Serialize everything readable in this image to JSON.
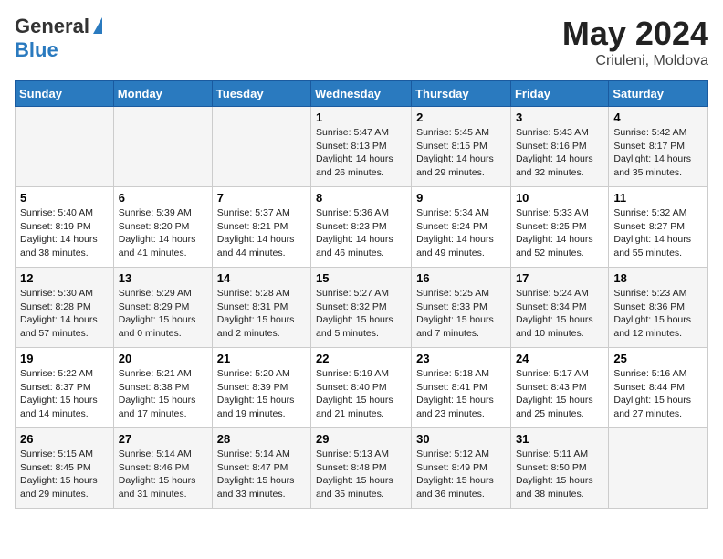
{
  "header": {
    "logo_general": "General",
    "logo_blue": "Blue",
    "title": "May 2024",
    "location": "Criuleni, Moldova"
  },
  "days_of_week": [
    "Sunday",
    "Monday",
    "Tuesday",
    "Wednesday",
    "Thursday",
    "Friday",
    "Saturday"
  ],
  "weeks": [
    [
      {
        "day": "",
        "info": ""
      },
      {
        "day": "",
        "info": ""
      },
      {
        "day": "",
        "info": ""
      },
      {
        "day": "1",
        "info": "Sunrise: 5:47 AM\nSunset: 8:13 PM\nDaylight: 14 hours and 26 minutes."
      },
      {
        "day": "2",
        "info": "Sunrise: 5:45 AM\nSunset: 8:15 PM\nDaylight: 14 hours and 29 minutes."
      },
      {
        "day": "3",
        "info": "Sunrise: 5:43 AM\nSunset: 8:16 PM\nDaylight: 14 hours and 32 minutes."
      },
      {
        "day": "4",
        "info": "Sunrise: 5:42 AM\nSunset: 8:17 PM\nDaylight: 14 hours and 35 minutes."
      }
    ],
    [
      {
        "day": "5",
        "info": "Sunrise: 5:40 AM\nSunset: 8:19 PM\nDaylight: 14 hours and 38 minutes."
      },
      {
        "day": "6",
        "info": "Sunrise: 5:39 AM\nSunset: 8:20 PM\nDaylight: 14 hours and 41 minutes."
      },
      {
        "day": "7",
        "info": "Sunrise: 5:37 AM\nSunset: 8:21 PM\nDaylight: 14 hours and 44 minutes."
      },
      {
        "day": "8",
        "info": "Sunrise: 5:36 AM\nSunset: 8:23 PM\nDaylight: 14 hours and 46 minutes."
      },
      {
        "day": "9",
        "info": "Sunrise: 5:34 AM\nSunset: 8:24 PM\nDaylight: 14 hours and 49 minutes."
      },
      {
        "day": "10",
        "info": "Sunrise: 5:33 AM\nSunset: 8:25 PM\nDaylight: 14 hours and 52 minutes."
      },
      {
        "day": "11",
        "info": "Sunrise: 5:32 AM\nSunset: 8:27 PM\nDaylight: 14 hours and 55 minutes."
      }
    ],
    [
      {
        "day": "12",
        "info": "Sunrise: 5:30 AM\nSunset: 8:28 PM\nDaylight: 14 hours and 57 minutes."
      },
      {
        "day": "13",
        "info": "Sunrise: 5:29 AM\nSunset: 8:29 PM\nDaylight: 15 hours and 0 minutes."
      },
      {
        "day": "14",
        "info": "Sunrise: 5:28 AM\nSunset: 8:31 PM\nDaylight: 15 hours and 2 minutes."
      },
      {
        "day": "15",
        "info": "Sunrise: 5:27 AM\nSunset: 8:32 PM\nDaylight: 15 hours and 5 minutes."
      },
      {
        "day": "16",
        "info": "Sunrise: 5:25 AM\nSunset: 8:33 PM\nDaylight: 15 hours and 7 minutes."
      },
      {
        "day": "17",
        "info": "Sunrise: 5:24 AM\nSunset: 8:34 PM\nDaylight: 15 hours and 10 minutes."
      },
      {
        "day": "18",
        "info": "Sunrise: 5:23 AM\nSunset: 8:36 PM\nDaylight: 15 hours and 12 minutes."
      }
    ],
    [
      {
        "day": "19",
        "info": "Sunrise: 5:22 AM\nSunset: 8:37 PM\nDaylight: 15 hours and 14 minutes."
      },
      {
        "day": "20",
        "info": "Sunrise: 5:21 AM\nSunset: 8:38 PM\nDaylight: 15 hours and 17 minutes."
      },
      {
        "day": "21",
        "info": "Sunrise: 5:20 AM\nSunset: 8:39 PM\nDaylight: 15 hours and 19 minutes."
      },
      {
        "day": "22",
        "info": "Sunrise: 5:19 AM\nSunset: 8:40 PM\nDaylight: 15 hours and 21 minutes."
      },
      {
        "day": "23",
        "info": "Sunrise: 5:18 AM\nSunset: 8:41 PM\nDaylight: 15 hours and 23 minutes."
      },
      {
        "day": "24",
        "info": "Sunrise: 5:17 AM\nSunset: 8:43 PM\nDaylight: 15 hours and 25 minutes."
      },
      {
        "day": "25",
        "info": "Sunrise: 5:16 AM\nSunset: 8:44 PM\nDaylight: 15 hours and 27 minutes."
      }
    ],
    [
      {
        "day": "26",
        "info": "Sunrise: 5:15 AM\nSunset: 8:45 PM\nDaylight: 15 hours and 29 minutes."
      },
      {
        "day": "27",
        "info": "Sunrise: 5:14 AM\nSunset: 8:46 PM\nDaylight: 15 hours and 31 minutes."
      },
      {
        "day": "28",
        "info": "Sunrise: 5:14 AM\nSunset: 8:47 PM\nDaylight: 15 hours and 33 minutes."
      },
      {
        "day": "29",
        "info": "Sunrise: 5:13 AM\nSunset: 8:48 PM\nDaylight: 15 hours and 35 minutes."
      },
      {
        "day": "30",
        "info": "Sunrise: 5:12 AM\nSunset: 8:49 PM\nDaylight: 15 hours and 36 minutes."
      },
      {
        "day": "31",
        "info": "Sunrise: 5:11 AM\nSunset: 8:50 PM\nDaylight: 15 hours and 38 minutes."
      },
      {
        "day": "",
        "info": ""
      }
    ]
  ]
}
